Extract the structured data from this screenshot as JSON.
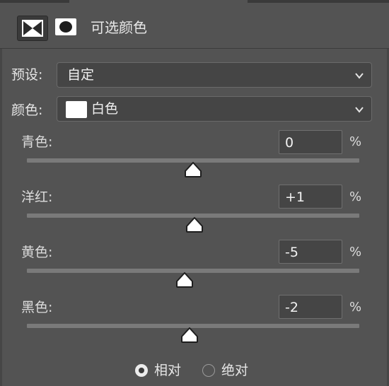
{
  "header": {
    "title": "可选颜色",
    "adjustment_icon": "selective-color-icon",
    "mask_icon": "layer-mask-icon"
  },
  "preset": {
    "label": "预设:",
    "value": "自定"
  },
  "colors": {
    "label": "颜色:",
    "value": "白色",
    "swatch_color": "#ffffff"
  },
  "sliders": [
    {
      "label": "青色:",
      "value": "0",
      "unit": "%",
      "level": 0
    },
    {
      "label": "洋红:",
      "value": "+1",
      "unit": "%",
      "level": 1
    },
    {
      "label": "黄色:",
      "value": "-5",
      "unit": "%",
      "level": -5
    },
    {
      "label": "黑色:",
      "value": "-2",
      "unit": "%",
      "level": -2
    }
  ],
  "method": {
    "options": [
      {
        "label": "相对",
        "checked": true
      },
      {
        "label": "绝对",
        "checked": false
      }
    ]
  }
}
